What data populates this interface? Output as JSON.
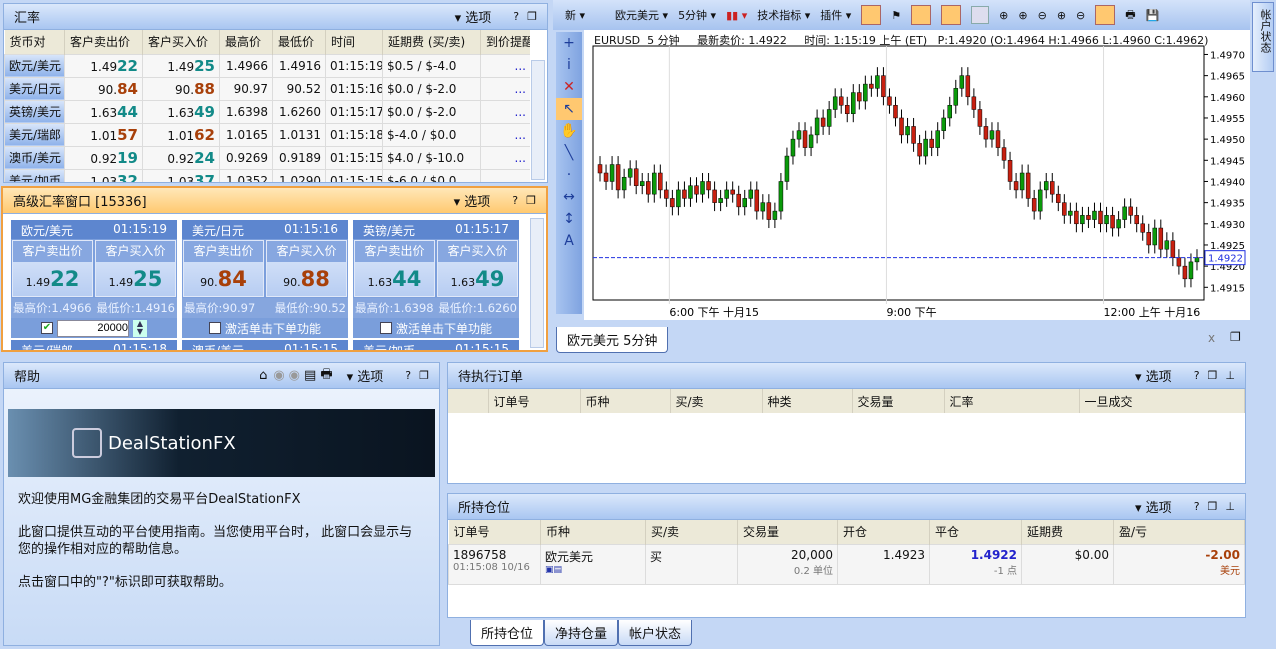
{
  "rates": {
    "title": "汇率",
    "options": "选项",
    "help": "?",
    "columns": [
      "货币对",
      "客户卖出价",
      "客户买入价",
      "最高价",
      "最低价",
      "时间",
      "延期费 (买/卖)",
      "到价提醒"
    ],
    "rows": [
      {
        "pair": "欧元/美元",
        "sell_pre": "1.49",
        "sell_big": "22",
        "buy_pre": "1.49",
        "buy_big": "25",
        "high": "1.4966",
        "low": "1.4916",
        "time": "01:15:19",
        "rollover": "$0.5 / $-4.0",
        "alert": "...",
        "color": "teal"
      },
      {
        "pair": "美元/日元",
        "sell_pre": "90.",
        "sell_big": "84",
        "buy_pre": "90.",
        "buy_big": "88",
        "high": "90.97",
        "low": "90.52",
        "time": "01:15:16",
        "rollover": "$0.0 / $-2.0",
        "alert": "...",
        "color": "brown"
      },
      {
        "pair": "英镑/美元",
        "sell_pre": "1.63",
        "sell_big": "44",
        "buy_pre": "1.63",
        "buy_big": "49",
        "high": "1.6398",
        "low": "1.6260",
        "time": "01:15:17",
        "rollover": "$0.0 / $-2.0",
        "alert": "...",
        "color": "teal"
      },
      {
        "pair": "美元/瑞郎",
        "sell_pre": "1.01",
        "sell_big": "57",
        "buy_pre": "1.01",
        "buy_big": "62",
        "high": "1.0165",
        "low": "1.0131",
        "time": "01:15:18",
        "rollover": "$-4.0 / $0.0",
        "alert": "...",
        "color": "brown"
      },
      {
        "pair": "澳币/美元",
        "sell_pre": "0.92",
        "sell_big": "19",
        "buy_pre": "0.92",
        "buy_big": "24",
        "high": "0.9269",
        "low": "0.9189",
        "time": "01:15:15",
        "rollover": "$4.0 / $-10.0",
        "alert": "...",
        "color": "teal"
      },
      {
        "pair": "美元/加币",
        "sell_pre": "1.03",
        "sell_big": "32",
        "buy_pre": "1.03",
        "buy_big": "37",
        "high": "1.0352",
        "low": "1.0290",
        "time": "01:15:15",
        "rollover": "$-6.0 / $0.0",
        "alert": "...",
        "color": "teal"
      }
    ]
  },
  "adv": {
    "title": "高级汇率窗口 [15336]",
    "options": "选项",
    "help": "?",
    "sell_label": "客户卖出价",
    "buy_label": "客户买入价",
    "oneclick": "激活单击下单功能",
    "qty": "20000",
    "cards": [
      {
        "pair": "欧元/美元",
        "time": "01:15:19",
        "sell_pre": "1.49",
        "sell_big": "22",
        "buy_pre": "1.49",
        "buy_big": "25",
        "hi": "最高价:1.4966",
        "lo": "最低价:1.4916",
        "color": "teal"
      },
      {
        "pair": "美元/日元",
        "time": "01:15:16",
        "sell_pre": "90.",
        "sell_big": "84",
        "buy_pre": "90.",
        "buy_big": "88",
        "hi": "最高价:90.97",
        "lo": "最低价:90.52",
        "color": "brown"
      },
      {
        "pair": "英镑/美元",
        "time": "01:15:17",
        "sell_pre": "1.63",
        "sell_big": "44",
        "buy_pre": "1.63",
        "buy_big": "49",
        "hi": "最高价:1.6398",
        "lo": "最低价:1.6260",
        "color": "teal"
      }
    ],
    "next": [
      {
        "pair": "美元/瑞郎",
        "time": "01:15:18"
      },
      {
        "pair": "澳币/美元",
        "time": "01:15:15"
      },
      {
        "pair": "美元/加币",
        "time": "01:15:15"
      }
    ]
  },
  "toolbar": {
    "new": "新",
    "symbol": "欧元美元",
    "interval": "5分钟",
    "indicators": "技术指标",
    "plugins": "插件"
  },
  "chart": {
    "info": "EURUSD  5 分钟     最新卖价: 1.4922     时间: 1:15:19 上午 (ET)   P:1.4920 (O:1.4964 H:1.4966 L:1.4960 C:1.4962)",
    "tab": "欧元美元 5分钟",
    "close": "x",
    "current_label": "1.4922",
    "side_tab": "帐户状态"
  },
  "chart_data": {
    "type": "candlestick",
    "symbol": "EURUSD",
    "interval": "5 分钟",
    "y_ticks": [
      "1.4970",
      "1.4965",
      "1.4960",
      "1.4955",
      "1.4950",
      "1.4945",
      "1.4940",
      "1.4935",
      "1.4930",
      "1.4925",
      "1.4920",
      "1.4915"
    ],
    "ylim": [
      1.4912,
      1.4972
    ],
    "x_ticks": [
      "6:00 下午 十月15",
      "9:00 下午",
      "12:00 上午 十月16"
    ],
    "current_price": 1.4922,
    "colors": {
      "up": "#0a9a0a",
      "down": "#c82010",
      "current": "#2030e0"
    },
    "closes": [
      1.4942,
      1.494,
      1.4944,
      1.4938,
      1.4941,
      1.4943,
      1.4939,
      1.494,
      1.4937,
      1.4942,
      1.4938,
      1.4936,
      1.4934,
      1.4938,
      1.4936,
      1.4939,
      1.4937,
      1.494,
      1.4938,
      1.4935,
      1.4936,
      1.4938,
      1.4937,
      1.4934,
      1.4936,
      1.4938,
      1.4933,
      1.4935,
      1.4931,
      1.4933,
      1.494,
      1.4946,
      1.495,
      1.4952,
      1.4948,
      1.4951,
      1.4955,
      1.4953,
      1.4957,
      1.496,
      1.4958,
      1.4956,
      1.4961,
      1.4959,
      1.4963,
      1.4962,
      1.4965,
      1.496,
      1.4958,
      1.4955,
      1.4951,
      1.4953,
      1.4949,
      1.4946,
      1.495,
      1.4948,
      1.4952,
      1.4955,
      1.4958,
      1.4962,
      1.4965,
      1.496,
      1.4957,
      1.4953,
      1.495,
      1.4952,
      1.4948,
      1.4945,
      1.494,
      1.4938,
      1.4942,
      1.4936,
      1.4933,
      1.4938,
      1.494,
      1.4937,
      1.4935,
      1.4932,
      1.4933,
      1.493,
      1.4932,
      1.4931,
      1.4933,
      1.493,
      1.4932,
      1.4929,
      1.4931,
      1.4934,
      1.4932,
      1.493,
      1.4928,
      1.4925,
      1.4929,
      1.4924,
      1.4926,
      1.4922,
      1.492,
      1.4917,
      1.4921,
      1.4922
    ]
  },
  "help": {
    "title": "帮助",
    "options": "选项",
    "brand": "DealStationFX",
    "p1": "欢迎使用MG金融集团的交易平台DealStationFX",
    "p2": "此窗口提供互动的平台使用指南。当您使用平台时， 此窗口会显示与您的操作相对应的帮助信息。",
    "p3": "点击窗口中的\"?\"标识即可获取帮助。"
  },
  "pending": {
    "title": "待执行订单",
    "options": "选项",
    "columns": [
      "订单号",
      "币种",
      "买/卖",
      "种类",
      "交易量",
      "汇率",
      "一旦成交"
    ]
  },
  "positions": {
    "title": "所持仓位",
    "options": "选项",
    "columns": [
      "订单号",
      "币种",
      "买/卖",
      "交易量",
      "开仓",
      "平仓",
      "延期费",
      "盈/亏"
    ],
    "rows": [
      {
        "id": "1896758",
        "time": "01:15:08 10/16",
        "symbol": "欧元美元",
        "side": "买",
        "qty": "20,000",
        "units": "0.2 单位",
        "open": "1.4923",
        "close": "1.4922",
        "pips": "-1 点",
        "rollover": "$0.00",
        "pl": "-2.00",
        "currency": "美元"
      }
    ],
    "tabs": [
      "所持仓位",
      "净持仓量",
      "帐户状态"
    ]
  }
}
